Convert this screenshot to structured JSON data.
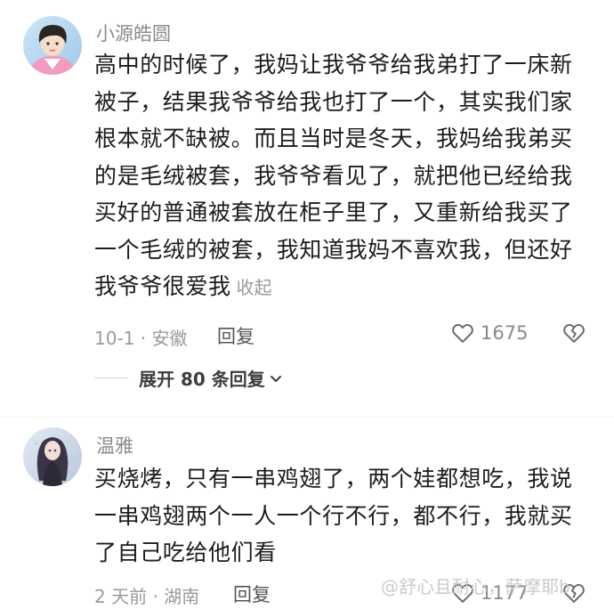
{
  "comments": [
    {
      "username": "小源皓圆",
      "lines": [
        "高中的时候了，我妈让我爷爷给我弟打了一床新",
        "被子，结果我爷爷给我也打了一个，其实我们家",
        "根本就不缺被。而且当时是冬天，我妈给我弟买",
        "的是毛绒被套，我爷爷看见了，就把他已经给我",
        "买好的普通被套放在柜子里了，又重新给我买了",
        "一个毛绒的被套，我知道我妈不喜欢我，但还好",
        "我爷爷很爱我"
      ],
      "collapse_label": "收起",
      "meta": "10-1 · 安徽",
      "reply_label": "回复",
      "like_count": "1675",
      "expand_label": "展开 80 条回复"
    },
    {
      "username": "温雅",
      "lines": [
        "买烧烤，只有一串鸡翅了，两个娃都想吃，我说",
        "一串鸡翅两个一人一个行不行，都不行，我就买",
        "了自己吃给他们看"
      ],
      "meta": "2 天前 · 湖南",
      "reply_label": "回复",
      "like_count": "1177"
    }
  ],
  "watermark": "@舒心且耐心，萨摩耶b",
  "icons": {
    "like": "heart-outline-icon",
    "dislike": "broken-heart-icon",
    "expand": "chevron-down-icon"
  }
}
